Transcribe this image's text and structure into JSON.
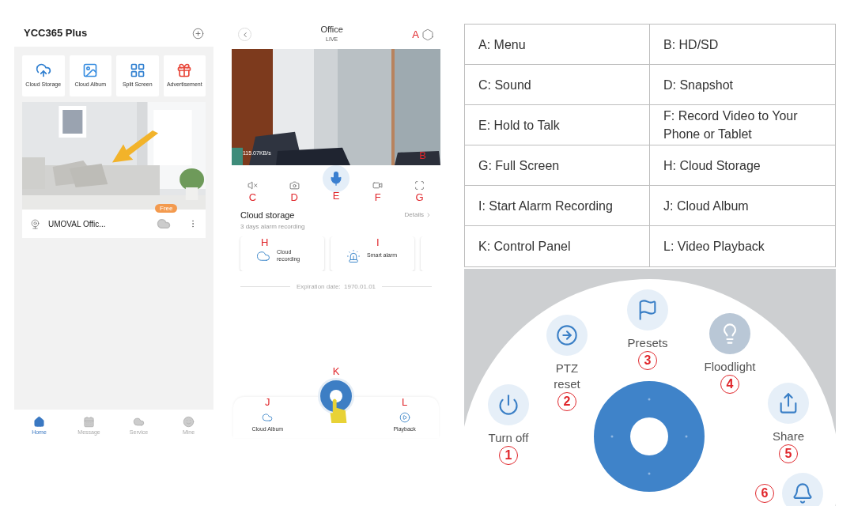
{
  "home_screen": {
    "title": "YCC365 Plus",
    "shortcuts": [
      {
        "kind": "cloud",
        "label": "Cloud Storage"
      },
      {
        "kind": "album",
        "label": "Cloud Album"
      },
      {
        "kind": "split",
        "label": "Split Screen"
      },
      {
        "kind": "ad",
        "label": "Advertisement"
      }
    ],
    "device": {
      "name": "UMOVAL Offic...",
      "badge": "Free"
    },
    "tabs": [
      {
        "kind": "home",
        "label": "Home",
        "selected": true
      },
      {
        "kind": "message",
        "label": "Message",
        "selected": false
      },
      {
        "kind": "service",
        "label": "Service",
        "selected": false
      },
      {
        "kind": "mine",
        "label": "Mine",
        "selected": false
      }
    ]
  },
  "live_screen": {
    "title": "Office",
    "subtitle": "LIVE",
    "menu_marker": "A",
    "speed": "115.07KB/s",
    "hd_marker": "B",
    "controls": [
      {
        "kind": "mute",
        "marker": "C",
        "selected": false
      },
      {
        "kind": "snapshot",
        "marker": "D",
        "selected": false
      },
      {
        "kind": "mic",
        "marker": "E",
        "selected": true
      },
      {
        "kind": "record",
        "marker": "F",
        "selected": false
      },
      {
        "kind": "fullscreen",
        "marker": "G",
        "selected": false
      }
    ],
    "cloud": {
      "title": "Cloud storage",
      "subtitle": "3 days alarm recording",
      "details": "Details",
      "cards": [
        {
          "kind": "cloud",
          "label": "Cloud recording",
          "marker": "H"
        },
        {
          "kind": "alarm",
          "label": "Smart alarm",
          "marker": "I"
        }
      ],
      "expiration": "Expiration date:  1970.01.01"
    },
    "bottom": [
      {
        "kind": "album",
        "label": "Cloud Album",
        "marker": "J"
      },
      {
        "kind": "panel",
        "marker": "K"
      },
      {
        "kind": "playback",
        "label": "Playback",
        "marker": "L"
      }
    ]
  },
  "legend": {
    "rows": [
      [
        "A: Menu",
        "B: HD/SD"
      ],
      [
        "C: Sound",
        "D: Snapshot"
      ],
      [
        "E: Hold to Talk",
        "F: Record Video to Your Phone or Tablet"
      ],
      [
        "G: Full Screen",
        "H: Cloud Storage"
      ],
      [
        "I: Start Alarm Recording",
        "J: Cloud Album"
      ],
      [
        "K: Control Panel",
        "L: Video Playback"
      ]
    ]
  },
  "control_panel": {
    "items": [
      {
        "kind": "power",
        "label": "Turn off",
        "number": "1",
        "on": true
      },
      {
        "kind": "ptz",
        "label": "PTZ reset",
        "number": "2",
        "on": true
      },
      {
        "kind": "presets",
        "label": "Presets",
        "number": "3",
        "on": true
      },
      {
        "kind": "floodlight",
        "label": "Floodlight",
        "number": "4",
        "on": false
      },
      {
        "kind": "share",
        "label": "Share",
        "number": "5",
        "on": true
      },
      {
        "kind": "bell",
        "number": "6",
        "on": true
      }
    ]
  }
}
